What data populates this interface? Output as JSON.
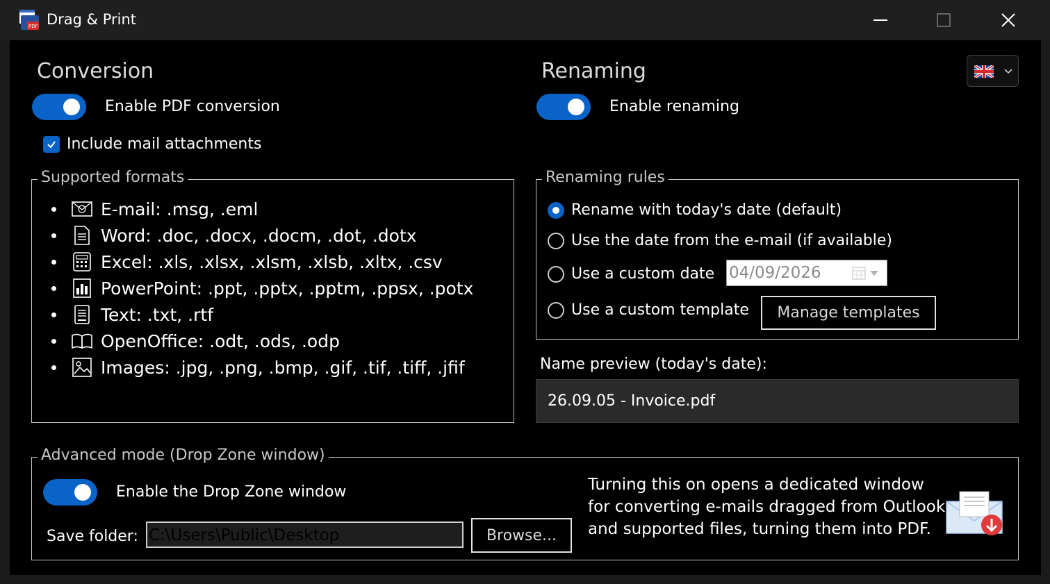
{
  "window": {
    "title": "Drag & Print",
    "icon": "drag-print-app-icon",
    "controls": [
      "minimize-icon",
      "maximize-icon",
      "close-icon"
    ]
  },
  "conversion": {
    "heading": "Conversion",
    "enable_label": "Enable PDF conversion",
    "enabled": true,
    "include_attachments_label": "Include mail attachments",
    "include_attachments_checked": true,
    "formats_legend": "Supported formats",
    "formats": [
      {
        "icon": "email-icon",
        "text": "E-mail: .msg, .eml"
      },
      {
        "icon": "word-document-icon",
        "text": "Word: .doc, .docx, .docm, .dot, .dotx"
      },
      {
        "icon": "excel-calculator-icon",
        "text": "Excel: .xls, .xlsx, .xlsm, .xlsb, .xltx, .csv"
      },
      {
        "icon": "powerpoint-chart-icon",
        "text": "PowerPoint: .ppt, .pptx, .pptm, .ppsx, .potx"
      },
      {
        "icon": "text-file-icon",
        "text": "Text: .txt, .rtf"
      },
      {
        "icon": "open-book-icon",
        "text": "OpenOffice: .odt, .ods, .odp"
      },
      {
        "icon": "image-icon",
        "text": "Images: .jpg, .png, .bmp, .gif, .tif, .tiff, .jfif"
      }
    ]
  },
  "renaming": {
    "heading": "Renaming",
    "enable_label": "Enable renaming",
    "enabled": true,
    "rules_legend": "Renaming rules",
    "rules": [
      {
        "label": "Rename with today's date (default)",
        "selected": true
      },
      {
        "label": "Use the date from the e-mail (if available)",
        "selected": false
      },
      {
        "label": "Use a custom date",
        "selected": false
      },
      {
        "label": "Use a custom template",
        "selected": false
      }
    ],
    "custom_date": "04/09/2026",
    "manage_templates_label": "Manage templates",
    "preview_label": "Name preview (today's date):",
    "preview_value": "26.09.05 - Invoice.pdf"
  },
  "language": {
    "flag": "uk-flag-icon",
    "dropdown_icon": "chevron-down-icon"
  },
  "advanced": {
    "legend": "Advanced mode (Drop Zone window)",
    "enable_label": "Enable the Drop Zone window",
    "enabled": true,
    "save_folder_label": "Save folder:",
    "save_folder_value": "C:\\Users\\Public\\Desktop",
    "browse_label": "Browse...",
    "description_lines": [
      "Turning this on opens a dedicated window",
      "for converting e-mails dragged from Outlook",
      "and supported files, turning them into PDF."
    ],
    "illustration": "mail-download-icon"
  },
  "colors": {
    "accent": "#0a64c8",
    "background": "#000000",
    "titlebar": "#1f1f1f"
  }
}
